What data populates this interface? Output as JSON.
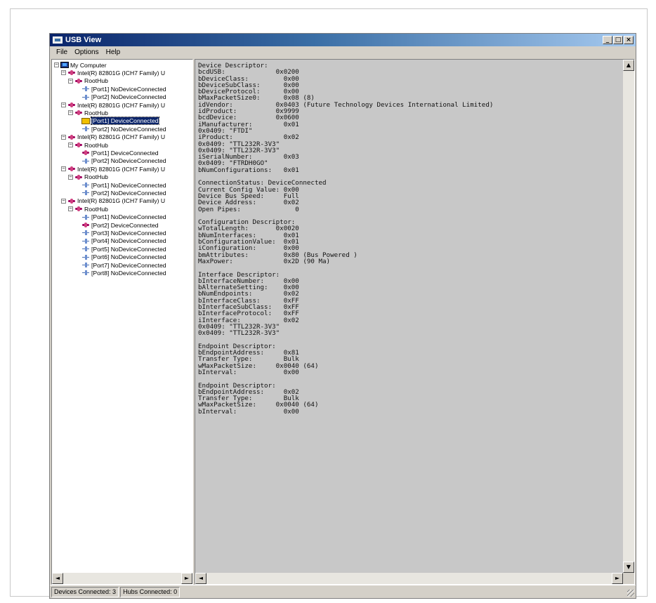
{
  "window": {
    "title": "USB View"
  },
  "title_buttons": {
    "minimize": "_",
    "maximize": "□",
    "close": "×"
  },
  "menu": [
    "File",
    "Options",
    "Help"
  ],
  "tree": [
    {
      "label": "My Computer",
      "icon": "computer",
      "expander": "−"
    },
    {
      "label": "Intel(R) 82801G (ICH7 Family) U",
      "icon": "hub",
      "expander": "−"
    },
    {
      "label": "RootHub",
      "icon": "hub",
      "expander": "−"
    },
    {
      "label": "[Port1] NoDeviceConnected",
      "icon": "port"
    },
    {
      "label": "[Port2] NoDeviceConnected",
      "icon": "port"
    },
    {
      "label": "Intel(R) 82801G (ICH7 Family) U",
      "icon": "hub",
      "expander": "−"
    },
    {
      "label": "RootHub",
      "icon": "hub",
      "expander": "−"
    },
    {
      "label": "[Port1] DeviceConnected",
      "icon": "dev",
      "selected": true
    },
    {
      "label": "[Port2] NoDeviceConnected",
      "icon": "port"
    },
    {
      "label": "Intel(R) 82801G (ICH7 Family) U",
      "icon": "hub",
      "expander": "−"
    },
    {
      "label": "RootHub",
      "icon": "hub",
      "expander": "−"
    },
    {
      "label": "[Port1] DeviceConnected",
      "icon": "hub"
    },
    {
      "label": "[Port2] NoDeviceConnected",
      "icon": "port"
    },
    {
      "label": "Intel(R) 82801G (ICH7 Family) U",
      "icon": "hub",
      "expander": "−"
    },
    {
      "label": "RootHub",
      "icon": "hub",
      "expander": "−"
    },
    {
      "label": "[Port1] NoDeviceConnected",
      "icon": "port"
    },
    {
      "label": "[Port2] NoDeviceConnected",
      "icon": "port"
    },
    {
      "label": "Intel(R) 82801G (ICH7 Family) U",
      "icon": "hub",
      "expander": "−"
    },
    {
      "label": "RootHub",
      "icon": "hub",
      "expander": "−"
    },
    {
      "label": "[Port1] NoDeviceConnected",
      "icon": "port"
    },
    {
      "label": "[Port2] DeviceConnected",
      "icon": "hub"
    },
    {
      "label": "[Port3] NoDeviceConnected",
      "icon": "port"
    },
    {
      "label": "[Port4] NoDeviceConnected",
      "icon": "port"
    },
    {
      "label": "[Port5] NoDeviceConnected",
      "icon": "port"
    },
    {
      "label": "[Port6] NoDeviceConnected",
      "icon": "port"
    },
    {
      "label": "[Port7] NoDeviceConnected",
      "icon": "port"
    },
    {
      "label": "[Port8] NoDeviceConnected",
      "icon": "port"
    }
  ],
  "details": [
    "Device Descriptor:",
    "bcdUSB:             0x0200",
    "bDeviceClass:         0x00",
    "bDeviceSubClass:      0x00",
    "bDeviceProtocol:      0x00",
    "bMaxPacketSize0:      0x08 (8)",
    "idVendor:           0x0403 (Future Technology Devices International Limited)",
    "idProduct:          0x9999",
    "bcdDevice:          0x0600",
    "iManufacturer:        0x01",
    "0x0409: \"FTDI\"",
    "iProduct:             0x02",
    "0x0409: \"TTL232R-3V3\"",
    "0x0409: \"TTL232R-3V3\"",
    "iSerialNumber:        0x03",
    "0x0409: \"FTRDH0GO\"",
    "bNumConfigurations:   0x01",
    "",
    "ConnectionStatus: DeviceConnected",
    "Current Config Value: 0x00",
    "Device Bus Speed:     Full",
    "Device Address:       0x02",
    "Open Pipes:              0",
    "",
    "Configuration Descriptor:",
    "wTotalLength:       0x0020",
    "bNumInterfaces:       0x01",
    "bConfigurationValue:  0x01",
    "iConfiguration:       0x00",
    "bmAttributes:         0x80 (Bus Powered )",
    "MaxPower:             0x2D (90 Ma)",
    "",
    "Interface Descriptor:",
    "bInterfaceNumber:     0x00",
    "bAlternateSetting:    0x00",
    "bNumEndpoints:        0x02",
    "bInterfaceClass:      0xFF",
    "bInterfaceSubClass:   0xFF",
    "bInterfaceProtocol:   0xFF",
    "iInterface:           0x02",
    "0x0409: \"TTL232R-3V3\"",
    "0x0409: \"TTL232R-3V3\"",
    "",
    "Endpoint Descriptor:",
    "bEndpointAddress:     0x81",
    "Transfer Type:        Bulk",
    "wMaxPacketSize:     0x0040 (64)",
    "bInterval:            0x00",
    "",
    "Endpoint Descriptor:",
    "bEndpointAddress:     0x02",
    "Transfer Type:        Bulk",
    "wMaxPacketSize:     0x0040 (64)",
    "bInterval:            0x00"
  ],
  "scroll": {
    "left": "◄",
    "right": "►",
    "up": "▲",
    "down": "▼"
  },
  "status": {
    "devices": "Devices Connected: 3",
    "hubs": "Hubs Connected: 0"
  }
}
